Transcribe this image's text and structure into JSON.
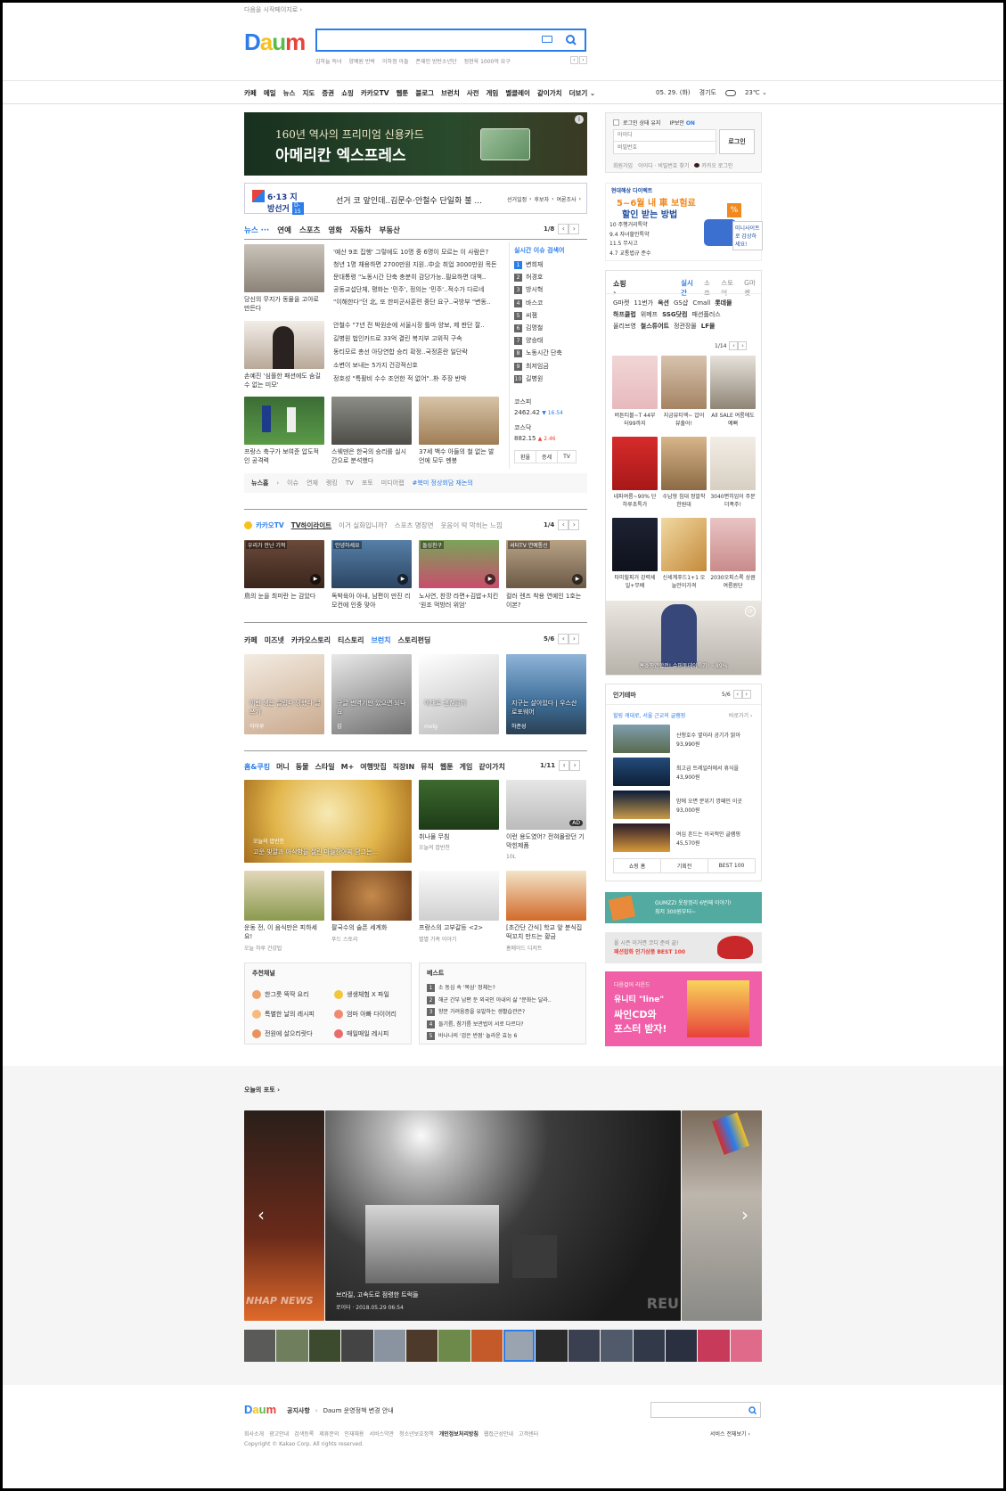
{
  "top": {
    "start_page": "다음을 시작페이지로"
  },
  "logo": {
    "text": "Daum"
  },
  "search": {
    "placeholder": "",
    "trending": [
      "김하늘 득녀",
      "양예원 반박",
      "이하정 아들",
      "폰재인 방탄소년단",
      "정현욱 1000억 요구"
    ]
  },
  "nav": {
    "items": [
      "카페",
      "메일",
      "뉴스",
      "지도",
      "증권",
      "쇼핑",
      "카카오TV",
      "웹툰",
      "블로그",
      "브런치",
      "사전",
      "게임",
      "벨클레이",
      "같이가치",
      "더보기"
    ],
    "date": "05. 29. (화)",
    "region": "경기도",
    "temp": "23℃"
  },
  "ads": {
    "amex_line1": "160년 역사의 프리미엄 신용카드",
    "amex_line2": "아메리칸 엑스프레스",
    "election_logo": "6·13 지방선거",
    "election_dday": "D-15",
    "election_text": "선거 코 앞인데..김문수·안철수 단일화 불 ...",
    "election_links": [
      "선거일정",
      "후보자",
      "여론조사"
    ]
  },
  "news": {
    "tabs": [
      "뉴스",
      "연예",
      "스포츠",
      "영화",
      "자동차",
      "부동산"
    ],
    "page": "1/8",
    "thumbs": [
      {
        "caption": "당신의 무지가 동물을 고아로 만든다"
      },
      {
        "caption": "손예진 '심플한 패션에도 숨길 수 없는 미모'"
      }
    ],
    "headlines1": [
      "'예산 9조 집행' 그렇에도 10명 중 6명이 모르는 이 사람은?",
      "청년 1명 채용하면 2700만원 지원..中企 취업 3000만원 목돈",
      "문대통령 \"노동시간 단축 충분히 감당가능..필요하면 대책..",
      "공동교섭단체, 평화는 '민주', 정의는 '민주'..적수가 다르네",
      "\"이해한다\"던 北, 또 한미군사훈련 중단 요구..국방부 \"변동.."
    ],
    "headlines2": [
      "안철수 \"7년 전 박원순에 서울시장 틀마 양보, 제 판단 잘..",
      "길병원 법인카드로 33억 결린 복지부 고위직 구속",
      "동티모르 총선 아당연합 승리 확정..국정혼란 일단락",
      "소변이 보내는 5가지 건강적신호",
      "정호성 \"특활비 수수 조언한 적 없어\"..朴 주장 반박"
    ],
    "realtime_title": "실시간 이슈 검색어",
    "realtime": [
      "변희재",
      "허경호",
      "방시혁",
      "바스코",
      "씨잼",
      "김명철",
      "양승태",
      "노동시간 단축",
      "최저임금",
      "길병원"
    ],
    "photo_captions": [
      "프랑스 축구가 보여준 압도적인 공격력",
      "스웨덴은 한국의 승리를 실시간으로 분석했다",
      "37세 백수 아들의 철 없는 발언에 모두 멘붕"
    ],
    "kospi_label": "코스피",
    "kospi_value": "2462.42",
    "kospi_change": "▼ 16.54",
    "kosdaq_label": "코스닥",
    "kosdaq_value": "882.15",
    "kosdaq_change": "▲ 2.46",
    "market_tabs": [
      "환율",
      "증세",
      "TV"
    ],
    "footer_label": "뉴스홈",
    "footer_links": [
      "이슈",
      "연재",
      "랭킹",
      "TV",
      "포토",
      "미디어랩"
    ],
    "footer_tag": "#북미 정상회담 재논의"
  },
  "kakaotv": {
    "title": "카카오TV",
    "tabs": [
      "TV하이라이트",
      "이거 실화입니까?",
      "스포츠 명장면",
      "웃음이 딱 막히는 느낌"
    ],
    "page": "1/4",
    "badges": [
      "우리가 만난 기적",
      "안녕하세요",
      "돌싱친구",
      "셔터TV 연예통신"
    ],
    "captions": [
      "鳥의 눈을 최미란 는 감았다",
      "독박육아 아내, 남편이 만진 리모컨에 인중 맞아",
      "노사연, 찬깡 라면+김밥+치킨 '원조 먹방러 위엄'",
      "컬러 렌즈 착용 연예인 1호는 이본?"
    ]
  },
  "story": {
    "tabs": [
      "카페",
      "미즈넷",
      "카카오스토리",
      "티스토리",
      "브런치",
      "스토리펀딩"
    ],
    "page": "5/6",
    "captions": [
      "이번 생은 글렀다 망했다 글쓰기",
      "구글 번역기만 있으면 되나요",
      "이대로 괜찮을까",
      "지구는 살아있다 | 우스산 로포웨어"
    ],
    "authors": [
      "이아루",
      "김",
      "molg",
      "하준성"
    ]
  },
  "home": {
    "tabs": [
      "홈&쿠킹",
      "머니",
      "동물",
      "스타일",
      "M+",
      "여행맛집",
      "직장IN",
      "뮤직",
      "웹툰",
      "게임",
      "같이가치"
    ],
    "page": "1/11",
    "big_caption_tag": "오늘의 밥반찬",
    "big_caption": "고운 빛깔과 아삭함을 살린 마늘장아찌 담그는...",
    "items": [
      {
        "caption": "취나물 무침",
        "source": "오늘의 밥반찬"
      },
      {
        "caption": "이런 용도였어? 전혀몰랐던 기막힌제품",
        "source": "10L"
      },
      {
        "caption": "운동 전, 이 음식만은 피하세요!",
        "source": "오늘 하루 건강탑"
      },
      {
        "caption": "팔국수의 술픈 세계화",
        "source": "푸드 스토리"
      },
      {
        "caption": "프랑스의 고부갈등 <2>",
        "source": "별별 가족 이야기"
      },
      {
        "caption": "[초간단 간식] 학교 앞 분식집 떡꼬치 만드는 황금",
        "source": "홈메이드 디저트"
      }
    ],
    "ad_badge": "AD",
    "rec_title": "추천채널",
    "rec": [
      "한그릇 뚝딱 요리",
      "생생체험 X 파일",
      "특별한 날의 레시피",
      "엄마 아빠 다이어리",
      "전원에 살으리랏다",
      "매일매일 레시피"
    ],
    "best_title": "베스트",
    "best": [
      "소 동심 속 '목삼' 정체는?",
      "해군 간부 남편 둔 외국인 아내의 삶 \"문화는 달라..",
      "향문 가려움증을 유발하는 생활습관은?",
      "들기름, 참기름 보관법이 서로 다르다?",
      "바나나의 '검은 반점' 놀라운 효능 6"
    ]
  },
  "login": {
    "keep": "로그인 상태 유지",
    "secure": "IP보안",
    "secure_state": "ON",
    "id_placeholder": "아이디",
    "pw_placeholder": "비밀번호",
    "button": "로그인",
    "signup": "회원가입",
    "find": "아이디 · 비밀번호 찾기",
    "kakao": "카카오 로그인"
  },
  "insurance": {
    "brand": "현대해상 다이렉트",
    "headline1": "5~6월 내 車 보험료",
    "headline2": "할인 받는 방법",
    "items": [
      "주행거리특약",
      "자녀할인특약",
      "무사고",
      "교통법규 준수"
    ],
    "nums": [
      "10",
      "9.4",
      "11.5",
      "4.7"
    ],
    "cta": "미니사이트로 감상하세요!"
  },
  "shopping": {
    "title": "쇼핑",
    "tabs": [
      "실시간",
      "소호",
      "스토어",
      "G마켓"
    ],
    "shops1": [
      "G마켓",
      "11번가",
      "옥션",
      "GS샵",
      "Cmall",
      "롯데몰"
    ],
    "shops2": [
      "하프클럽",
      "위메프",
      "SSG닷컴",
      "패션플러스"
    ],
    "shops3": [
      "올리브영",
      "철스튜어트",
      "정관장몰",
      "LF몰"
    ],
    "page": "1/14",
    "products": [
      "버튼티볼~T 44부터99까지",
      "지금뷰티엑~ 압어뷰출어!",
      "All SALE 여름에도 예뻐",
      "네파여름~90% 단하루초특가",
      "수납형 침대 정말착한원대",
      "3040편히입어 주문더폭주!",
      "타미힐피거 강력세일+무배",
      "신세계푸드1+1 오늘만이가격",
      "2030오피스룩 상큼여름원단"
    ],
    "banner": "홈쇼핑연합전! 슈퍼투데이특가! ~89%"
  },
  "theme": {
    "title": "인기테마",
    "page": "5/6",
    "subtitle": "힐링 캐대로, 서울 근교의 글램핑",
    "more": "바로가기",
    "items": [
      {
        "name": "산청호수 옆이라 공기가 맑아",
        "price": "93,990원"
      },
      {
        "name": "최고급 트레일러에서 휴식을",
        "price": "43,900원"
      },
      {
        "name": "밤에 오면 분위기 깡패인 이곳",
        "price": "93,000원"
      },
      {
        "name": "여심 흔드는 이국적인 글램핑",
        "price": "45,570원"
      }
    ],
    "footer": [
      "쇼핑 홈",
      "기획전",
      "BEST 100"
    ]
  },
  "side_ads": {
    "gumzzi1": "GUMZZI 옷장정리 6번째 이야기!",
    "gumzzi2": "최저 300원부터~",
    "fashion1": "올 시즌 이거면 코디 준비 끝!",
    "fashion2": "패션잡화 인기상품 BEST 100",
    "line1": "다음걸어 라운드",
    "line2": "유니티 \"line\"",
    "line3": "싸인CD와",
    "line4": "포스터 받자!"
  },
  "photo": {
    "title": "오늘의 포토",
    "caption": "브라질, 고속도로 점령한 트럭들",
    "meta": "로이터 · 2018.05.29 06:54",
    "left_watermark": "NHAP NEWS",
    "right_watermark": "REU"
  },
  "footer": {
    "notice_label": "공지사항",
    "notice": "Daum 운영정책 변경 안내",
    "links": [
      "회사소개",
      "광고안내",
      "검색등록",
      "제휴문의",
      "인재채용",
      "서비스약관",
      "청소년보호정책",
      "개인정보처리방침",
      "웹접근성안내",
      "고객센터"
    ],
    "all_services": "서비스 전체보기",
    "copyright": "Copyright © Kakao Corp. All rights reserved."
  },
  "colors": {
    "accent": "#2b7de9",
    "brand_red": "#e8423a",
    "brand_green": "#5aba4a",
    "brand_yellow": "#f6c11c"
  }
}
